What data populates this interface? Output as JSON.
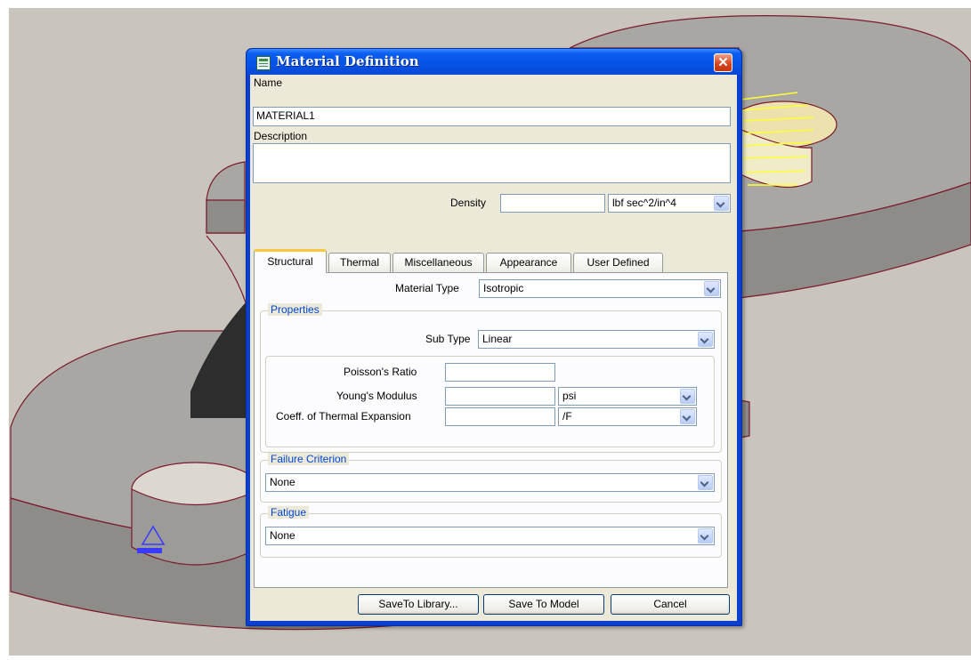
{
  "dialog": {
    "title": "Material Definition",
    "close_symbol": "✕",
    "name_label": "Name",
    "name_value": "MATERIAL1",
    "description_label": "Description",
    "description_value": "",
    "density_label": "Density",
    "density_value": "",
    "density_unit": "lbf sec^2/in^4"
  },
  "tabs": [
    {
      "label": "Structural",
      "active": true
    },
    {
      "label": "Thermal"
    },
    {
      "label": "Miscellaneous"
    },
    {
      "label": "Appearance"
    },
    {
      "label": "User Defined"
    }
  ],
  "structural": {
    "material_type_label": "Material Type",
    "material_type_value": "Isotropic",
    "properties_group": "Properties",
    "sub_type_label": "Sub Type",
    "sub_type_value": "Linear",
    "poisson_label": "Poisson's Ratio",
    "poisson_value": "",
    "youngs_label": "Young's Modulus",
    "youngs_value": "",
    "youngs_unit": "psi",
    "thermal_exp_label": "Coeff. of Thermal Expansion",
    "thermal_exp_value": "",
    "thermal_exp_unit": "/F",
    "failure_group": "Failure Criterion",
    "failure_value": "None",
    "fatigue_group": "Fatigue",
    "fatigue_value": "None"
  },
  "buttons": {
    "save_library": "SaveTo Library...",
    "save_model": "Save To Model",
    "cancel": "Cancel"
  },
  "icons": {
    "app": "material-icon",
    "close": "close-icon",
    "dropdown": "chevron-down-icon"
  },
  "colors": {
    "title_blue": "#0a5ef0",
    "panel": "#ece9d8",
    "model_gray": "#a9a7a4",
    "model_edge": "#7a1a2a",
    "background": "#c9c4bc",
    "load_arrows": "#ffff33",
    "constraint": "#3a3aff"
  }
}
